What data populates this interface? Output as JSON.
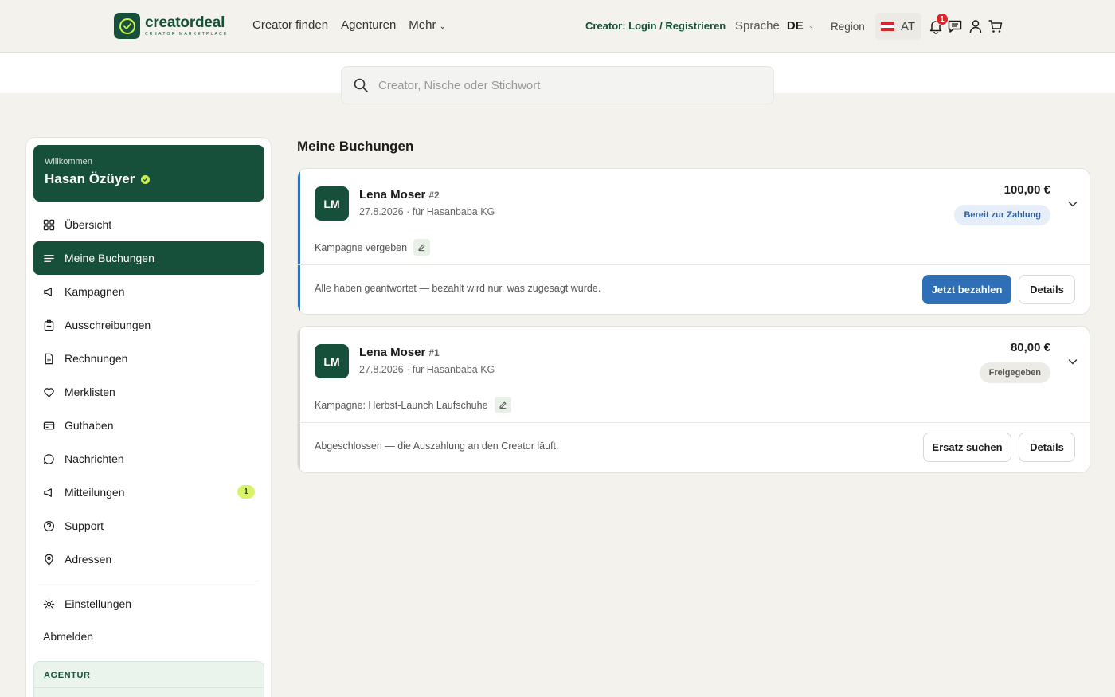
{
  "header": {
    "logo_name": "creatordeal",
    "logo_tagline": "CREATOR MARKETPLACE",
    "nav": [
      "Creator finden",
      "Agenturen",
      "Mehr"
    ],
    "creator_link": "Creator: Login / Registrieren",
    "language_label": "Sprache",
    "language_value": "DE",
    "region_label": "Region",
    "region_value": "AT",
    "notification_count": "1",
    "icons": [
      "bell-icon",
      "chat-icon",
      "user-icon",
      "cart-icon"
    ]
  },
  "search": {
    "placeholder": "Creator, Nische oder Stichwort"
  },
  "sidebar": {
    "welcome_label": "Willkommen",
    "user_name": "Hasan Özüyer",
    "items": [
      {
        "label": "Übersicht",
        "icon": "grid-icon"
      },
      {
        "label": "Meine Buchungen",
        "icon": "list-icon",
        "active": true
      },
      {
        "label": "Kampagnen",
        "icon": "megaphone-icon"
      },
      {
        "label": "Ausschreibungen",
        "icon": "clipboard-icon"
      },
      {
        "label": "Rechnungen",
        "icon": "invoice-icon"
      },
      {
        "label": "Merklisten",
        "icon": "heart-icon"
      },
      {
        "label": "Guthaben",
        "icon": "card-icon"
      },
      {
        "label": "Nachrichten",
        "icon": "message-icon"
      },
      {
        "label": "Mitteilungen",
        "icon": "announcement-icon",
        "count": "1"
      },
      {
        "label": "Support",
        "icon": "help-icon"
      },
      {
        "label": "Adressen",
        "icon": "location-icon"
      }
    ],
    "settings_label": "Einstellungen",
    "logout_label": "Abmelden",
    "agency_section": "AGENTUR"
  },
  "main": {
    "title": "Meine Buchungen",
    "bookings": [
      {
        "initials": "LM",
        "creator": "Lena Moser",
        "number": "#2",
        "meta": "27.8.2026 · für Hasanbaba KG",
        "price": "100,00 €",
        "status": "Bereit zur Zahlung",
        "status_bg": "#e6eefa",
        "status_fg": "#2f5f9c",
        "accent": "#2f6fb7",
        "campaign": "Kampagne vergeben",
        "note": "Alle haben geantwortet — bezahlt wird nur, was zugesagt wurde.",
        "primary_action": "Jetzt bezahlen",
        "secondary_action": "Details"
      },
      {
        "initials": "LM",
        "creator": "Lena Moser",
        "number": "#1",
        "meta": "27.8.2026 · für Hasanbaba KG",
        "price": "80,00 €",
        "status": "Freigegeben",
        "status_bg": "#ecebe5",
        "status_fg": "#555555",
        "accent": "#d6d5cf",
        "campaign": "Kampagne: Herbst-Launch Laufschuhe",
        "note": "Abgeschlossen — die Auszahlung an den Creator läuft.",
        "primary_action": "Ersatz suchen",
        "secondary_action": "Details"
      }
    ]
  },
  "colors": {
    "brand": "#17503a",
    "accent_lime": "#c9ef52",
    "primary_button": "#2f6fb7"
  }
}
